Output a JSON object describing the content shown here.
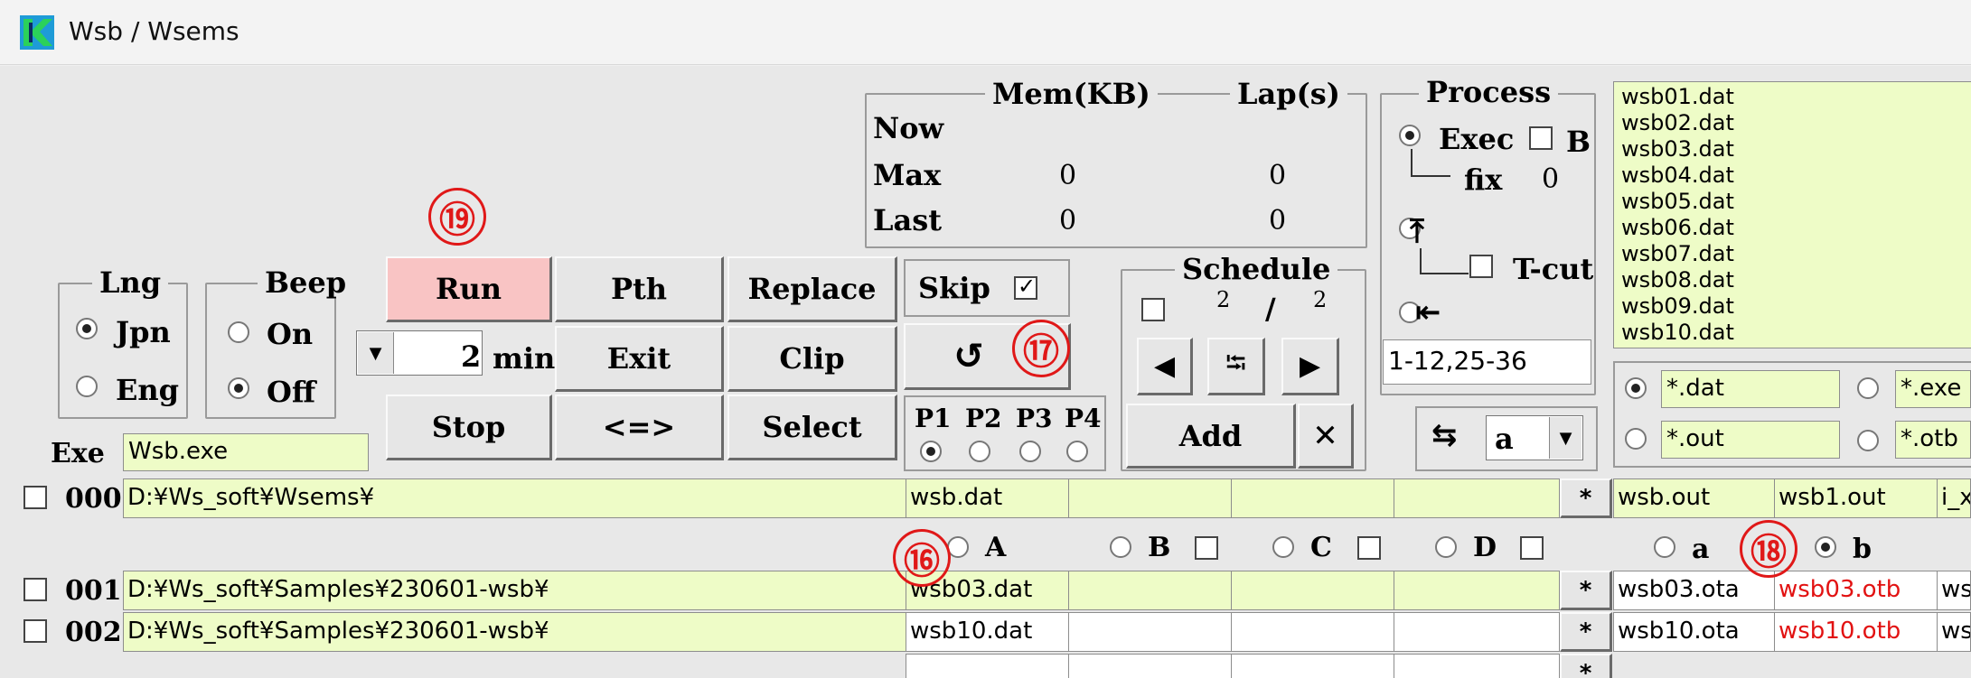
{
  "window": {
    "title": "Wsb / Wsems"
  },
  "mem": {
    "header_mem": "Mem(KB)",
    "header_lap": "Lap(s)",
    "rows": [
      {
        "label": "Now",
        "mem": "",
        "lap": ""
      },
      {
        "label": "Max",
        "mem": "0",
        "lap": "0"
      },
      {
        "label": "Last",
        "mem": "0",
        "lap": "0"
      }
    ]
  },
  "process": {
    "title": "Process",
    "exec_label": "Exec",
    "exec_selected": true,
    "b_label": "B",
    "fix_label": "fix",
    "fix_value": "0",
    "tcut_label": "T-cut",
    "range_value": "1-12,25-36"
  },
  "file_list": [
    "wsb01.dat",
    "wsb02.dat",
    "wsb03.dat",
    "wsb04.dat",
    "wsb05.dat",
    "wsb06.dat",
    "wsb07.dat",
    "wsb08.dat",
    "wsb09.dat",
    "wsb10.dat"
  ],
  "filters": [
    {
      "value": "*.dat",
      "selected": true
    },
    {
      "value": "*.exe",
      "selected": false
    },
    {
      "value": "*.out",
      "selected": false
    },
    {
      "value": "*.otb",
      "selected": false
    }
  ],
  "lng": {
    "title": "Lng",
    "options": [
      "Jpn",
      "Eng"
    ],
    "selected": "Jpn"
  },
  "beep": {
    "title": "Beep",
    "options": [
      "On",
      "Off"
    ],
    "selected": "Off"
  },
  "buttons": {
    "run": "Run",
    "pth": "Pth",
    "replace": "Replace",
    "exit": "Exit",
    "clip": "Clip",
    "stop": "Stop",
    "swap": "<=>",
    "select": "Select",
    "refresh": "↺",
    "add": "Add",
    "delete": "✕"
  },
  "interval": {
    "value": "2",
    "unit": "min"
  },
  "skip": {
    "label": "Skip",
    "checked": true
  },
  "priority": {
    "labels": [
      "P1",
      "P2",
      "P3",
      "P4"
    ],
    "selected": "P1"
  },
  "schedule": {
    "title": "Schedule",
    "current": "2",
    "slash": "/",
    "total": "2"
  },
  "mode_select": {
    "value": "a"
  },
  "exe": {
    "label": "Exe",
    "value": "Wsb.exe"
  },
  "markers": [
    "⑲",
    "⑰",
    "⑯",
    "⑱"
  ],
  "rows": [
    {
      "index": "000",
      "path": "D:¥Ws_soft¥Wsems¥",
      "in": "wsb.dat",
      "in2": "",
      "in3": "",
      "in4": "",
      "star": "*",
      "out_a": "wsb.out",
      "out_b": "wsb1.out",
      "out_c": "i_x"
    },
    {
      "index": "001",
      "path": "D:¥Ws_soft¥Samples¥230601-wsb¥",
      "in": "wsb03.dat",
      "in2": "",
      "in3": "",
      "in4": "",
      "star": "*",
      "out_a": "wsb03.ota",
      "out_b": "wsb03.otb",
      "out_c": "ws"
    },
    {
      "index": "002",
      "path": "D:¥Ws_soft¥Samples¥230601-wsb¥",
      "in": "wsb10.dat",
      "in2": "",
      "in3": "",
      "in4": "",
      "star": "*",
      "out_a": "wsb10.ota",
      "out_b": "wsb10.otb",
      "out_c": "ws"
    }
  ],
  "row3_star": "*",
  "input_cols": {
    "a": "A",
    "b": "B",
    "c": "C",
    "d": "D"
  },
  "output_cols": {
    "a": "a",
    "b": "b",
    "b_selected": true
  }
}
